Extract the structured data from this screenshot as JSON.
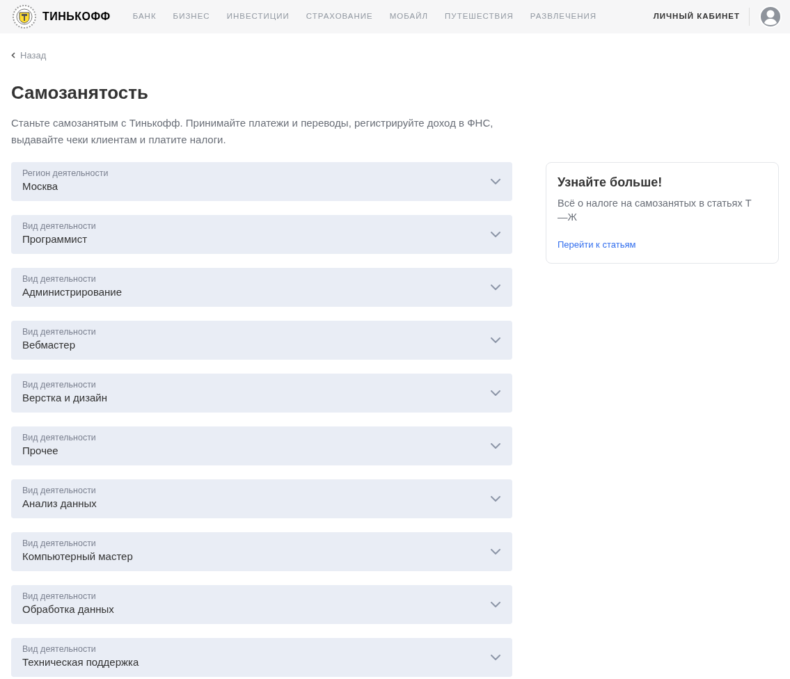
{
  "header": {
    "logo_text": "ТИНЬКОФФ",
    "nav": [
      "БАНК",
      "БИЗНЕС",
      "ИНВЕСТИЦИИ",
      "СТРАХОВАНИЕ",
      "МОБАЙЛ",
      "ПУТЕШЕСТВИЯ",
      "РАЗВЛЕЧЕНИЯ"
    ],
    "account_link": "ЛИЧНЫЙ КАБИНЕТ"
  },
  "back_link": "Назад",
  "title": "Самозанятость",
  "description": "Станьте самозанятым с Тинькофф. Принимайте платежи и переводы, регистрируйте доход в ФНС, выдавайте чеки клиентам и платите налоги.",
  "fields": [
    {
      "label": "Регион деятельности",
      "value": "Москва"
    },
    {
      "label": "Вид деятельности",
      "value": "Программист"
    },
    {
      "label": "Вид деятельности",
      "value": "Администрирование"
    },
    {
      "label": "Вид деятельности",
      "value": "Вебмастер"
    },
    {
      "label": "Вид деятельности",
      "value": "Верстка и дизайн"
    },
    {
      "label": "Вид деятельности",
      "value": "Прочее"
    },
    {
      "label": "Вид деятельности",
      "value": "Анализ данных"
    },
    {
      "label": "Вид деятельности",
      "value": "Компьютерный мастер"
    },
    {
      "label": "Вид деятельности",
      "value": "Обработка данных"
    },
    {
      "label": "Вид деятельности",
      "value": "Техническая поддержка"
    }
  ],
  "info_card": {
    "title": "Узнайте больше!",
    "text": "Всё о налоге на самозанятых в статьях Т—Ж",
    "link": "Перейти к статьям"
  }
}
